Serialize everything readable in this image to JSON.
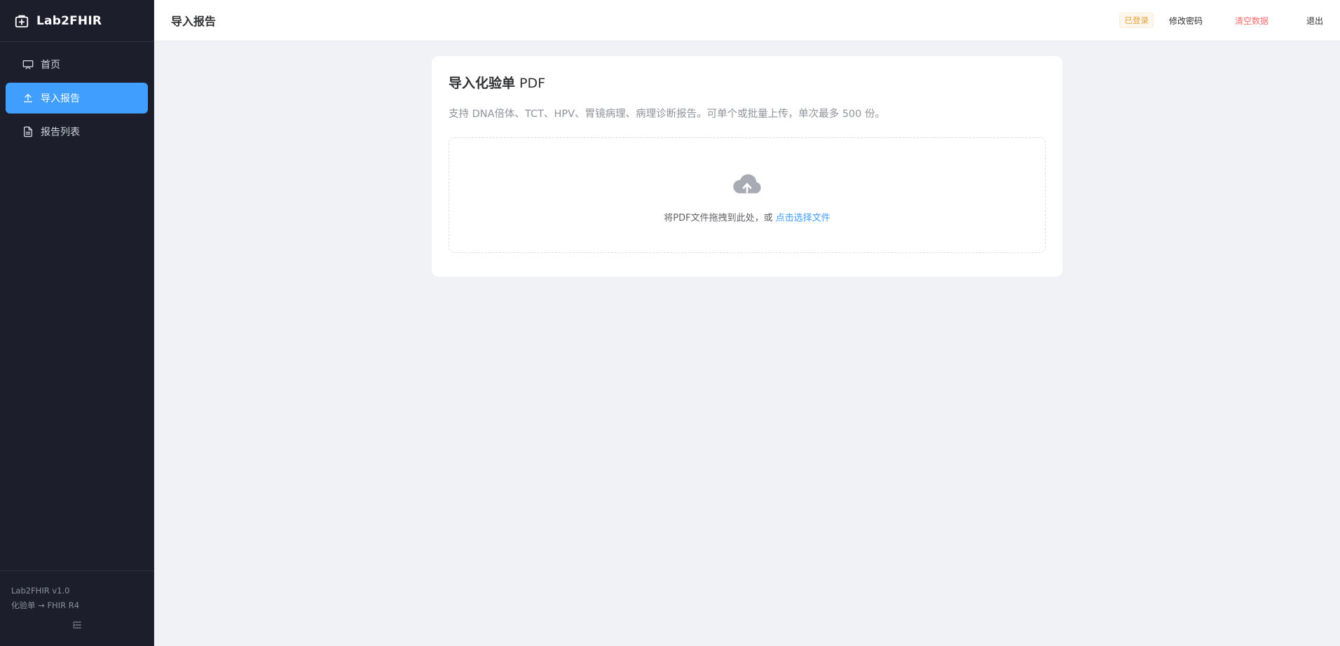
{
  "app": {
    "name": "Lab2FHIR"
  },
  "sidebar": {
    "items": [
      {
        "label": "首页",
        "icon": "monitor-icon"
      },
      {
        "label": "导入报告",
        "icon": "upload-icon",
        "active": true
      },
      {
        "label": "报告列表",
        "icon": "document-icon"
      }
    ],
    "footer": {
      "version": "Lab2FHIR v1.0",
      "tagline": "化验单 → FHIR R4"
    }
  },
  "header": {
    "title": "导入报告",
    "status_badge": "已登录",
    "change_password": "修改密码",
    "clear_data": "清空数据",
    "logout": "退出"
  },
  "upload": {
    "title_main": "导入化验单",
    "title_suffix": " PDF",
    "description": "支持 DNA倍体、TCT、HPV、胃镜病理、病理诊断报告。可单个或批量上传，单次最多 500 份。",
    "drop_text": "将PDF文件拖拽到此处，或 ",
    "select_link": "点击选择文件"
  },
  "colors": {
    "sidebar_bg": "#1c1f2b",
    "accent": "#409eff",
    "danger": "#f56c6c",
    "warning": "#e6a23c"
  }
}
